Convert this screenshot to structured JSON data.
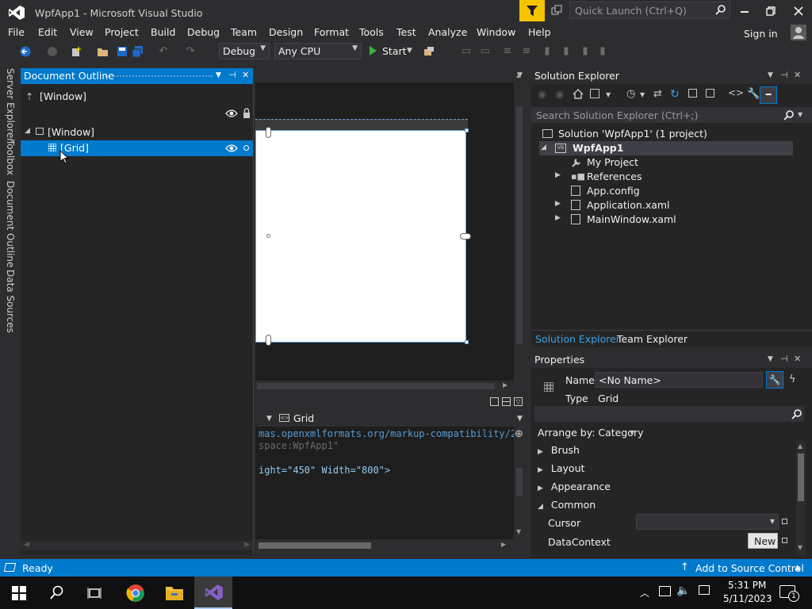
{
  "window": {
    "title": "WpfApp1 - Microsoft Visual Studio"
  },
  "quick_launch": {
    "placeholder": "Quick Launch (Ctrl+Q)"
  },
  "menu": [
    "File",
    "Edit",
    "View",
    "Project",
    "Build",
    "Debug",
    "Team",
    "Design",
    "Format",
    "Tools",
    "Test",
    "Analyze",
    "Window",
    "Help"
  ],
  "sign_in": "Sign in",
  "toolbar": {
    "configuration": "Debug",
    "platform": "Any CPU",
    "start_label": "Start"
  },
  "left_tabs": [
    "Server Explorer",
    "Toolbox",
    "Document Outline",
    "Data Sources"
  ],
  "document_outline": {
    "title": "Document Outline",
    "root_label": "[Window]",
    "tree": [
      {
        "label": "[Window]"
      },
      {
        "label": "[Grid]"
      }
    ]
  },
  "xaml_editor": {
    "element_combo": "Grid",
    "lines": [
      "mas.openxmlformats.org/markup-compatibility/20",
      "space:WpfApp1\"",
      "",
      "ight=\"450\" Width=\"800\">"
    ]
  },
  "solution_explorer": {
    "title": "Solution Explorer",
    "search_placeholder": "Search Solution Explorer (Ctrl+;)",
    "items": [
      {
        "label": "Solution 'WpfApp1' (1 project)"
      },
      {
        "label": "WpfApp1"
      },
      {
        "label": "My Project"
      },
      {
        "label": "References"
      },
      {
        "label": "App.config"
      },
      {
        "label": "Application.xaml"
      },
      {
        "label": "MainWindow.xaml"
      }
    ],
    "tabs": [
      "Solution Explorer",
      "Team Explorer"
    ]
  },
  "properties": {
    "title": "Properties",
    "name_label": "Name",
    "name_value": "<No Name>",
    "type_label": "Type",
    "type_value": "Grid",
    "arrange_by": "Arrange by: Category",
    "categories": [
      "Brush",
      "Layout",
      "Appearance",
      "Common"
    ],
    "rows": [
      {
        "label": "Cursor"
      },
      {
        "label": "DataContext",
        "button": "New"
      }
    ]
  },
  "status": {
    "text": "Ready",
    "source_control": "Add to Source Control"
  },
  "taskbar": {
    "time": "5:31 PM",
    "date": "5/11/2023",
    "notifications": "1"
  },
  "colors": {
    "accent": "#007acc",
    "background": "#2d2d30",
    "panel": "#252526",
    "editor": "#1e1e1e"
  }
}
